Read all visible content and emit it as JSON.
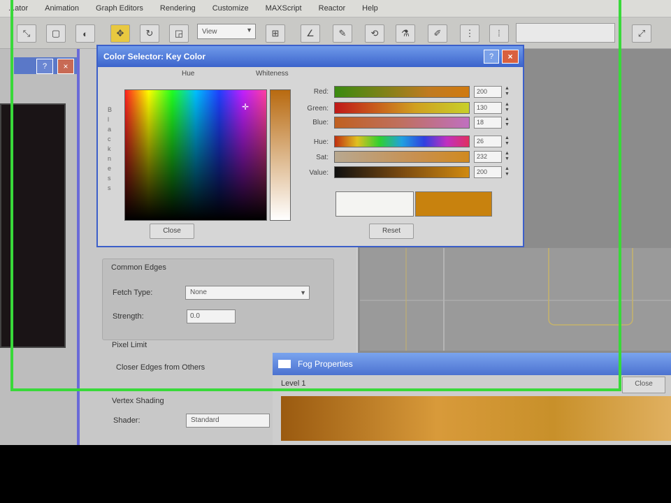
{
  "menubar": {
    "items": [
      "...ator",
      "Animation",
      "Graph Editors",
      "Rendering",
      "Customize",
      "MAXScript",
      "Reactor",
      "Help"
    ]
  },
  "toolbar": {
    "view_combo": "View"
  },
  "left_panel": {
    "help_glyph": "?",
    "close_glyph": "×"
  },
  "material_panel": {
    "section1": "Common Edges",
    "flatten_label": "Fetch Type:",
    "flatten_value": "None",
    "strength_label": "Strength:",
    "strength_value": "0.0",
    "section2": "Pixel Limit",
    "pixel_label": "Closer Edges from Others",
    "section3": "Vertex Shading",
    "shade_label": "Shader:",
    "shade_value": "Standard"
  },
  "color_dialog": {
    "title": "Color Selector: Key Color",
    "help_glyph": "?",
    "close_glyph": "×",
    "tabs": [
      "Hue",
      "Whiteness"
    ],
    "blackness_ticks": [
      "B",
      "l",
      "a",
      "c",
      "k",
      "n",
      "e",
      "s",
      "s"
    ],
    "sliders": [
      {
        "label": "Red:",
        "value": "200"
      },
      {
        "label": "Green:",
        "value": "130"
      },
      {
        "label": "Blue:",
        "value": "18"
      },
      {
        "label": "Hue:",
        "value": "26"
      },
      {
        "label": "Sat:",
        "value": "232"
      },
      {
        "label": "Value:",
        "value": "200"
      }
    ],
    "accent_color": "#c8820e",
    "close_button": "Close",
    "reset_button": "Reset"
  },
  "second_window": {
    "title": "Fog Properties",
    "label": "Level 1",
    "button": "Close"
  }
}
